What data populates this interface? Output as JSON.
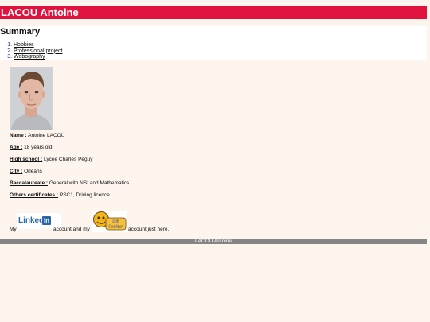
{
  "header": {
    "title": "LACOU Antoine"
  },
  "summary": {
    "heading": "Summary",
    "items": [
      {
        "label": "Hobbies"
      },
      {
        "label": "Professional project"
      },
      {
        "label": "Webography"
      }
    ]
  },
  "profile": {
    "fields": [
      {
        "label": "Name :",
        "value": "Antoine LACOU"
      },
      {
        "label": "Age :",
        "value": "18 years old"
      },
      {
        "label": "High school :",
        "value": "Lycée Charles Péguy"
      },
      {
        "label": "City :",
        "value": "Orléans"
      },
      {
        "label": "Baccalaureate :",
        "value": "General with NSI and Mathematics"
      },
      {
        "label": "Others certificates :",
        "value": "PSC1, Driving licence"
      }
    ]
  },
  "accounts": {
    "text_before": "My",
    "text_middle": "account and my",
    "text_after": "account just here.",
    "linkedin_logo": {
      "text": "Linked",
      "suffix": "in"
    },
    "stil_logo": {
      "text": "Stil Contact"
    }
  },
  "footer": {
    "text": "LACOU Antoine"
  },
  "colors": {
    "header_bg": "#e0133f",
    "page_bg": "#fdf4ee",
    "footer_bg": "#858585",
    "linkedin_blue": "#2a67a8"
  }
}
